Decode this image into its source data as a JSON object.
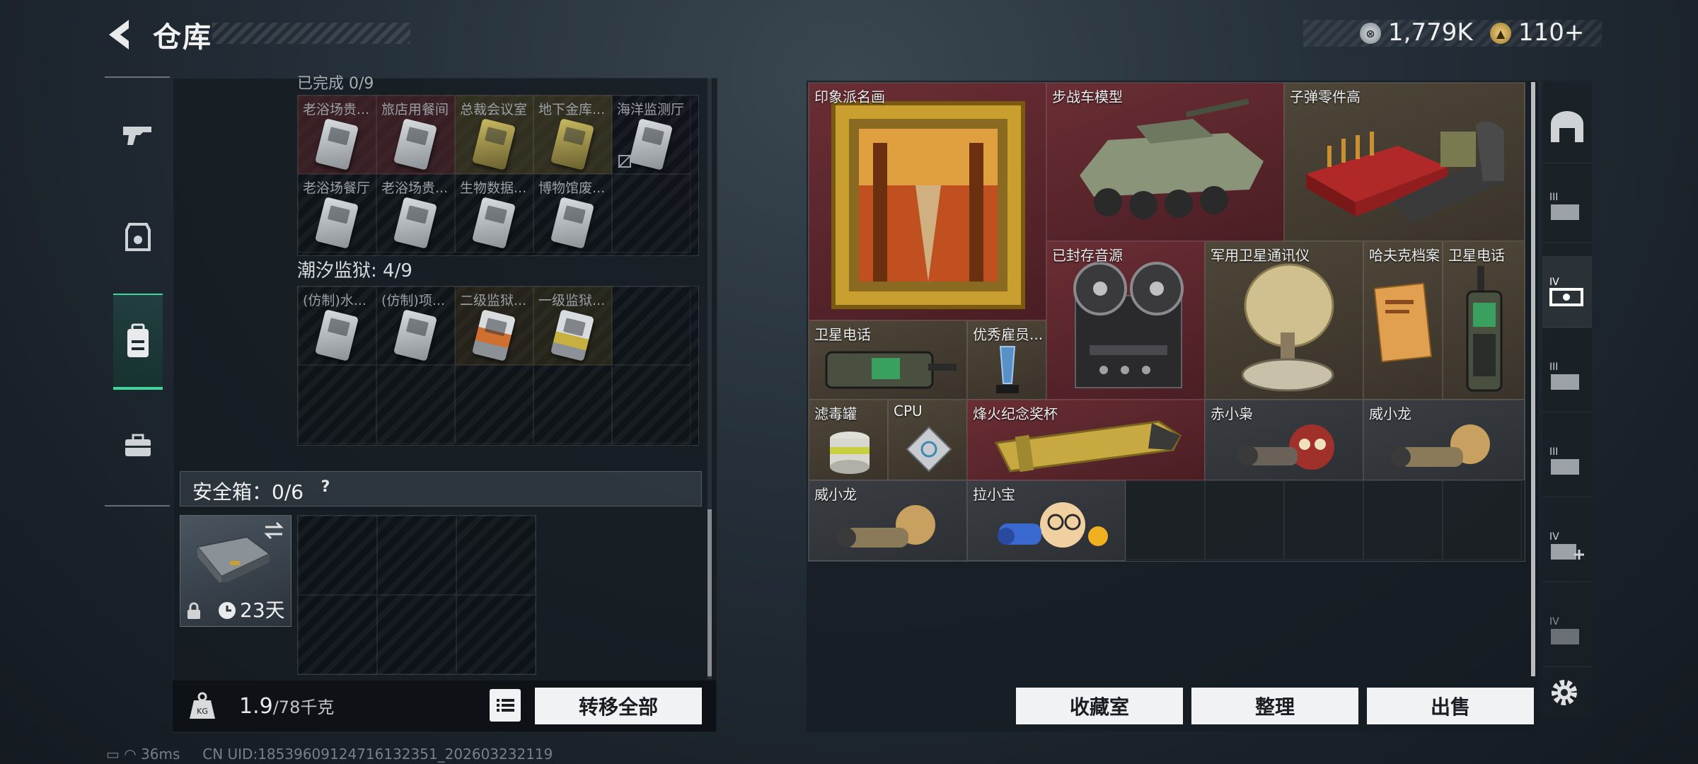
{
  "header": {
    "title": "仓库",
    "coin_value": "1,779K",
    "bond_value": "110+"
  },
  "left_panel": {
    "section_a_title": "已完成 0/9",
    "section_a_cells": [
      "老浴场贵...",
      "旅店用餐间",
      "总裁会议室",
      "地下金库...",
      "海洋监测厅",
      "老浴场餐厅",
      "老浴场贵...",
      "生物数据...",
      "博物馆废..."
    ],
    "section_b_title": "潮汐监狱: 4/9",
    "section_b_cells": [
      "(仿制)水...",
      "(仿制)项...",
      "二级监狱...",
      "一级监狱..."
    ],
    "safebox_title": "安全箱：0/6",
    "safebox_help": "?",
    "safebox_days": "23天",
    "weight_value": "1.9",
    "weight_max": "/78千克",
    "transfer_label": "转移全部"
  },
  "items": [
    {
      "label": "印象派名画",
      "bg": "red"
    },
    {
      "label": "步战车模型",
      "bg": "red"
    },
    {
      "label": "子弹零件高",
      "bg": "gold"
    },
    {
      "label": "已封存音源",
      "bg": "red"
    },
    {
      "label": "军用卫星通讯仪",
      "bg": "gold"
    },
    {
      "label": "哈夫克档案",
      "bg": "gold"
    },
    {
      "label": "卫星电话",
      "bg": "gold"
    },
    {
      "label": "卫星电话",
      "bg": "gold"
    },
    {
      "label": "优秀雇员...",
      "bg": "gold"
    },
    {
      "label": "滤毒罐",
      "bg": "gold"
    },
    {
      "label": "CPU",
      "bg": "gold"
    },
    {
      "label": "烽火纪念奖杯",
      "bg": "red"
    },
    {
      "label": "赤小枭",
      "bg": "dark"
    },
    {
      "label": "威小龙",
      "bg": "dark"
    },
    {
      "label": "威小龙",
      "bg": "dark"
    },
    {
      "label": "拉小宝",
      "bg": "dark"
    }
  ],
  "buttons": {
    "collection": "收藏室",
    "sort": "整理",
    "sell": "出售"
  },
  "right_nav": [
    "III",
    "IV",
    "III",
    "III",
    "IV",
    "IV"
  ],
  "status": {
    "ping": "36ms",
    "uid": "CN UID:18539609124716132351_202603232119"
  },
  "colors": {
    "accent_green": "#3fd6a0",
    "item_red": "#5a2a30",
    "item_gold": "#4a4234"
  }
}
